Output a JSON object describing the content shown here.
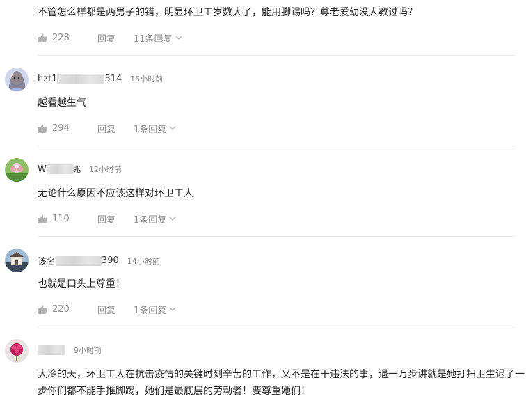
{
  "comments": [
    {
      "text": "不管怎么样都是两男子的错，明显环卫工岁数大了，能用脚踢吗？尊老爱幼没人教过吗？",
      "likes": "228",
      "reply_label": "回复",
      "replies_label": "11条回复"
    },
    {
      "username_prefix": "hzt1",
      "username_suffix": "514",
      "time": "15小时前",
      "text": "越看越生气",
      "likes": "294",
      "reply_label": "回复",
      "replies_label": "1条回复"
    },
    {
      "username_prefix": "W",
      "username_suffix": "兆",
      "time": "12小时前",
      "text": "无论什么原因不应该这样对环卫工人",
      "likes": "110",
      "reply_label": "回复",
      "replies_label": "1条回复"
    },
    {
      "username_prefix": "该名",
      "username_suffix": "390",
      "time": "14小时前",
      "text": "也就是口头上尊重！",
      "likes": "220",
      "reply_label": "回复",
      "replies_label": "1条回复"
    },
    {
      "time": "9小时前",
      "text": "大冷的天，环卫工人在抗击疫情的关键时刻辛苦的工作，又不是在干违法的事，退一万步讲就是她打扫卫生迟了一步你们都不能手推脚踢，她们是最底层的劳动者！要尊重她们！"
    }
  ],
  "icons": {
    "like": "thumbs-up-icon",
    "expand": "chevron-down-icon"
  },
  "colors": {
    "meta_text": "#8f8f8f",
    "body_text": "#222222",
    "divider": "#ececec"
  }
}
